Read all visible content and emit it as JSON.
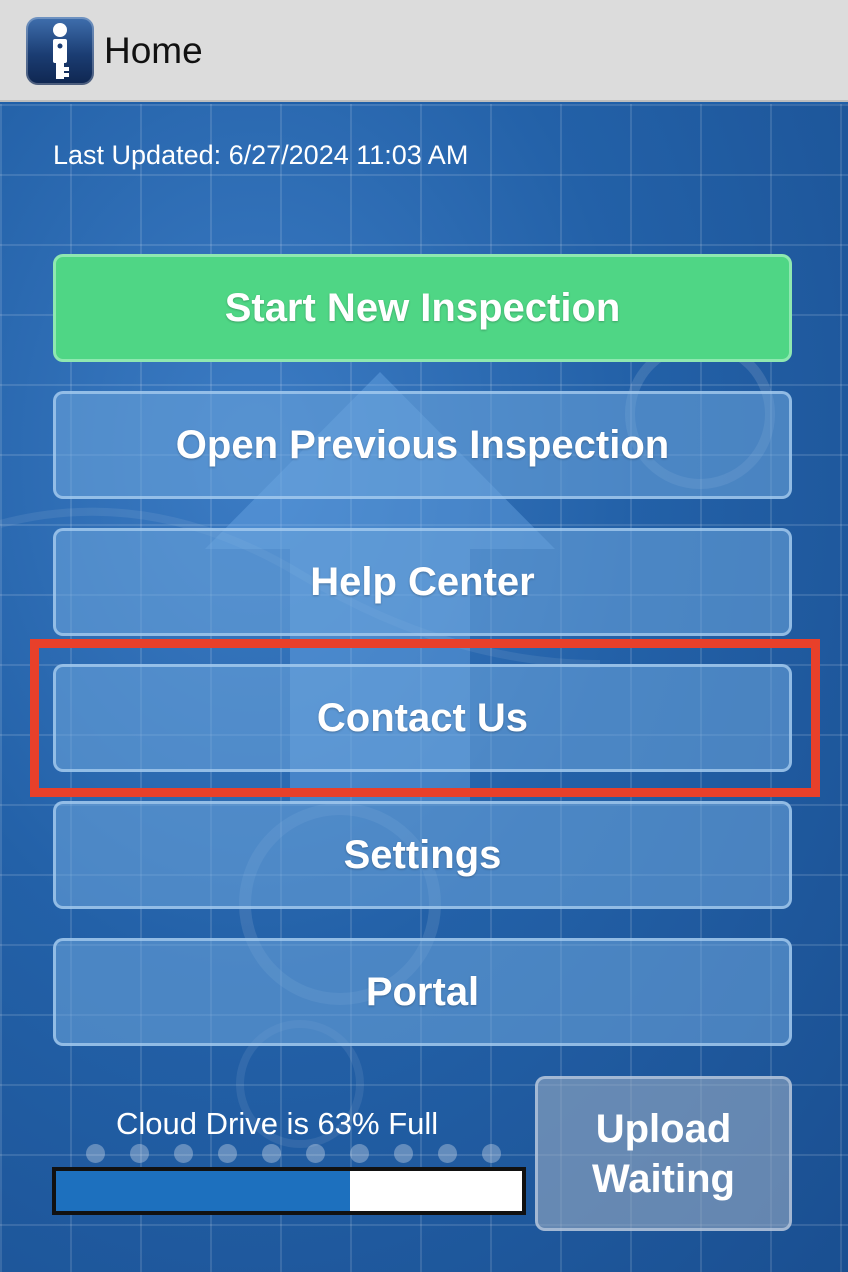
{
  "header": {
    "title": "Home",
    "icon": "inspector-key-icon"
  },
  "status": {
    "last_updated": "Last Updated: 6/27/2024 11:03 AM"
  },
  "menu": {
    "start_new_inspection": "Start New Inspection",
    "open_previous_inspection": "Open Previous Inspection",
    "help_center": "Help Center",
    "contact_us": "Contact Us",
    "settings": "Settings",
    "portal": "Portal"
  },
  "storage": {
    "label": "Cloud Drive is 63% Full",
    "percent_full": 63
  },
  "upload": {
    "line1": "Upload",
    "line2": "Waiting"
  },
  "colors": {
    "primary_button": "#4fd685",
    "highlight": "#e8402a",
    "progress_fill": "#1d70be",
    "background": "#2361a8"
  }
}
